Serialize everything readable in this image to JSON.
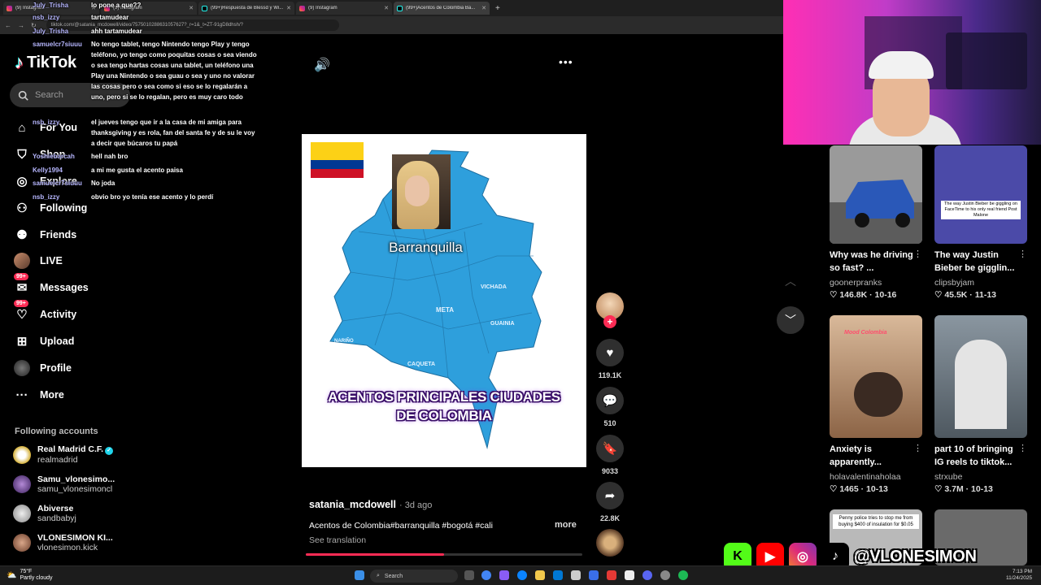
{
  "browser": {
    "tabs": [
      {
        "label": "(9) Instagram",
        "type": "instagram"
      },
      {
        "label": "(9) Instagram",
        "type": "instagram"
      },
      {
        "label": "(99+)Respuesta de Blessd y Wi...",
        "type": "tiktok"
      },
      {
        "label": "(9) Instagram",
        "type": "instagram"
      },
      {
        "label": "(99+)Acentos de Colombia Ba...",
        "type": "tiktok"
      }
    ],
    "url": "tiktok.com/@satania_mcdowell/video/7575010288631057627?_r=1&_t=ZT-91gD8dhsh/?"
  },
  "sidebar": {
    "logo": "TikTok",
    "search_placeholder": "Search",
    "items": [
      {
        "label": "For You",
        "icon": "home-icon",
        "glyph": "⌂"
      },
      {
        "label": "Shop",
        "icon": "shop-icon",
        "glyph": "⛉"
      },
      {
        "label": "Explore",
        "icon": "compass-icon",
        "glyph": "◎"
      },
      {
        "label": "Following",
        "icon": "following-icon",
        "glyph": "⚇"
      },
      {
        "label": "Friends",
        "icon": "friends-icon",
        "glyph": "⚉"
      },
      {
        "label": "LIVE",
        "icon": "live-avatar-icon",
        "glyph": ""
      },
      {
        "label": "Messages",
        "icon": "messages-icon",
        "glyph": "✉",
        "badge": "99+"
      },
      {
        "label": "Activity",
        "icon": "activity-icon",
        "glyph": "♡",
        "badge": "99+"
      },
      {
        "label": "Upload",
        "icon": "upload-icon",
        "glyph": "⊞"
      },
      {
        "label": "Profile",
        "icon": "profile-avatar-icon",
        "glyph": ""
      },
      {
        "label": "More",
        "icon": "more-icon",
        "glyph": "···"
      }
    ],
    "following_title": "Following accounts",
    "accounts": [
      {
        "name": "Real Madrid C.F.",
        "handle": "realmadrid",
        "verified": true
      },
      {
        "name": "Samu_vlonesimo...",
        "handle": "samu_vlonesimoncl",
        "verified": false
      },
      {
        "name": "Abiverse",
        "handle": "sandbabyj",
        "verified": false
      },
      {
        "name": "VLONESIMON KI...",
        "handle": "vlonesimon.kick",
        "verified": false
      }
    ]
  },
  "chat": [
    {
      "user": "July_Trisha",
      "text": "lo pone a que??"
    },
    {
      "user": "nsb_izzy",
      "text": "tartamudear"
    },
    {
      "user": "July_Trisha",
      "text": "ahh tartamudear"
    },
    {
      "user": "samuelcr7siuuu",
      "text": "No tengo tablet, tengo Nintendo tengo Play y tengo teléfono, yo tengo como poquitas cosas o sea viendo o sea tengo hartas cosas una tablet, un teléfono una Play una Nintendo o sea guau o sea y uno no valorar las cosas pero o sea como si eso se lo regalarán a uno, pero si se lo regalan, pero es muy caro todo"
    },
    {
      "user": "nsb_izzy",
      "text": "el jueves tengo que ir a la casa de mi amiga para thanksgiving y es rola, fan del santa fe y de su le voy a decir que búcaros tu papá"
    },
    {
      "user": "Yoshiebarcah",
      "text": "hell nah bro"
    },
    {
      "user": "Kelly1994",
      "text": "a mi me gusta el acento paisa"
    },
    {
      "user": "samuelcr7siuuu",
      "text": "No joda"
    },
    {
      "user": "nsb_izzy",
      "text": "obvio bro yo tenía ese acento y lo perdí"
    }
  ],
  "video": {
    "city_label": "Barranquilla",
    "title_line1": "ACENTOS PRINCIPALES CIUDADES",
    "title_line2": "DE COLOMBIA",
    "regions": [
      "VICHADA",
      "META",
      "GUAINIA",
      "CAQUETA",
      "NARIÑO"
    ],
    "progress": 0.5,
    "author": "satania_mcdowell",
    "time": "· 3d ago",
    "caption": "Acentos de Colombia#barranquilla #bogotá #cali",
    "more": "more",
    "see_translation": "See translation"
  },
  "actions": {
    "likes": "119.1K",
    "comments": "510",
    "saves": "9033",
    "shares": "22.8K"
  },
  "grid": [
    {
      "title": "Why was he driving so fast? ...",
      "author": "goonerpranks",
      "likes": "146.8K",
      "date": "10-16",
      "thumb_color": "#4a6a9a"
    },
    {
      "title": "The way Justin Bieber be gigglin...",
      "author": "clipsbyjam",
      "likes": "45.5K",
      "date": "11-13",
      "thumb_color": "#4b4aa8",
      "overlay": "The way Justin Bieber be giggling on FaceTime to his only real friend Post Malone"
    },
    {
      "title": "Anxiety is apparently...",
      "author": "holavalentinaholaa",
      "likes": "1465",
      "date": "10-13",
      "thumb_color": "#c9a07a",
      "overlay": "Mood Colombia"
    },
    {
      "title": "part 10 of bringing IG reels to tiktok...",
      "author": "strxube",
      "likes": "3.7M",
      "date": "10-13",
      "thumb_color": "#7c8a96"
    },
    {
      "title": "",
      "author": "",
      "likes": "",
      "date": "",
      "thumb_color": "#b9b9b9",
      "overlay": "Penny police tries to stop me from buying $400 of insulation for $0.05"
    },
    {
      "title": "",
      "author": "",
      "likes": "",
      "date": "",
      "thumb_color": "#6a6a6a"
    }
  ],
  "socials": {
    "handle": "@VLONESIMON",
    "platforms": [
      "kick",
      "youtube",
      "instagram",
      "tiktok"
    ]
  },
  "taskbar": {
    "temp": "75°F",
    "weather": "Partly cloudy",
    "search": "Search",
    "time": "7:13 PM",
    "date": "11/24/2025"
  }
}
